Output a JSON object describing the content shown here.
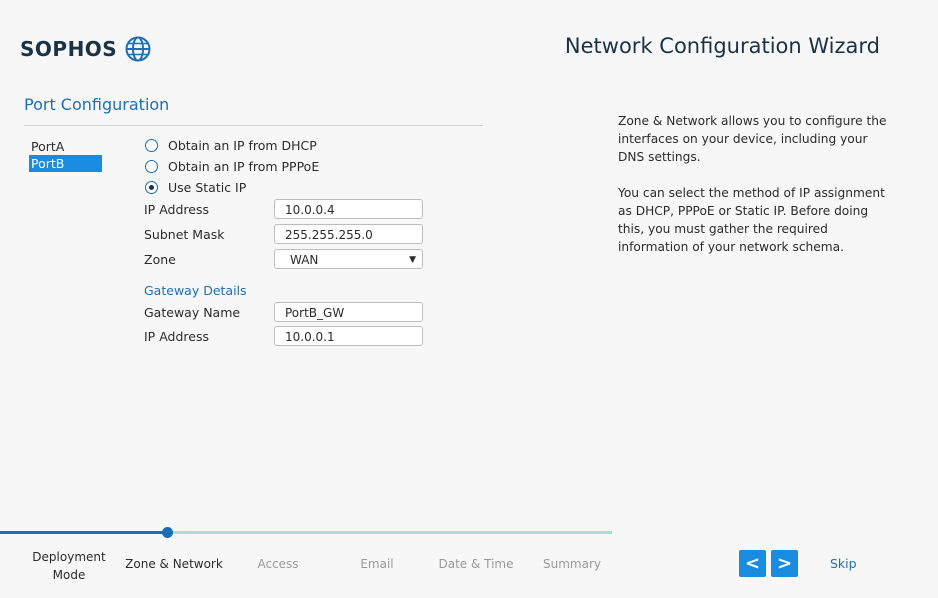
{
  "brand": {
    "name": "SOPHOS",
    "logo_icon": "globe-icon",
    "color": "#1a3245"
  },
  "header": {
    "title": "Network Configuration Wizard"
  },
  "section": {
    "title": "Port Configuration"
  },
  "ports": [
    {
      "label": "PortA",
      "selected": false
    },
    {
      "label": "PortB",
      "selected": true
    }
  ],
  "ip_options": [
    {
      "label": "Obtain an IP from DHCP",
      "checked": false
    },
    {
      "label": "Obtain an IP from PPPoE",
      "checked": false
    },
    {
      "label": "Use Static IP",
      "checked": true
    }
  ],
  "fields": {
    "ip_address": {
      "label": "IP Address",
      "value": "10.0.0.4"
    },
    "subnet_mask": {
      "label": "Subnet Mask",
      "value": "255.255.255.0"
    },
    "zone": {
      "label": "Zone",
      "value": "WAN"
    }
  },
  "gateway": {
    "title": "Gateway Details",
    "name": {
      "label": "Gateway Name",
      "value": "PortB_GW"
    },
    "ip_address": {
      "label": "IP Address",
      "value": "10.0.0.1"
    }
  },
  "help": {
    "paragraph1": "Zone & Network allows you to configure the interfaces on your device, including your DNS settings.",
    "paragraph2": "You can select the method of IP assignment as DHCP, PPPoE or Static IP. Before doing this, you must gather the required information of your network schema."
  },
  "steps": [
    {
      "label": "Deployment Mode",
      "state": "done"
    },
    {
      "label": "Zone & Network",
      "state": "current"
    },
    {
      "label": "Access",
      "state": "pending"
    },
    {
      "label": "Email",
      "state": "pending"
    },
    {
      "label": "Date & Time",
      "state": "pending"
    },
    {
      "label": "Summary",
      "state": "pending"
    }
  ],
  "progress": {
    "fraction": 0.274
  },
  "nav": {
    "back_label": "<",
    "next_label": ">",
    "skip_label": "Skip"
  },
  "colors": {
    "accent": "#1a8ce0",
    "link": "#1d6fb5",
    "progress_track": "#a9dbec"
  }
}
